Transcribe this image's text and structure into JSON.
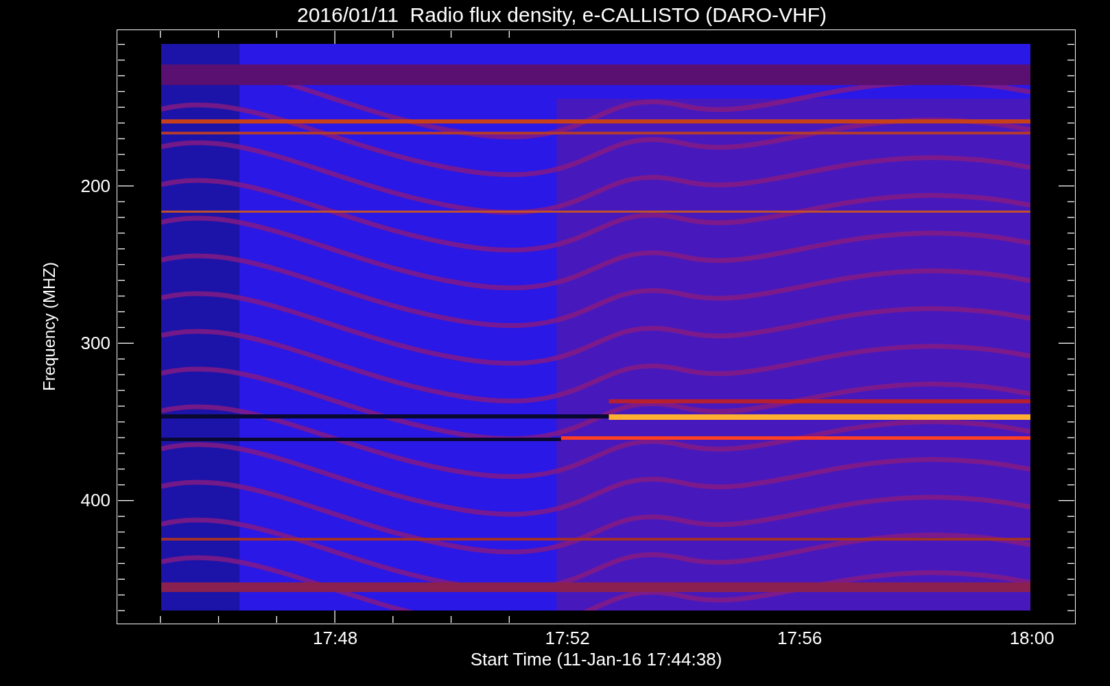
{
  "title": "2016/01/11  Radio flux density, e-CALLISTO (DARO-VHF)",
  "y_axis": {
    "label": "Frequency (MHZ)",
    "ticks": [
      "200",
      "300",
      "400"
    ]
  },
  "x_axis": {
    "label": "Start Time (11-Jan-16 17:44:38)",
    "ticks": [
      "17:48",
      "17:52",
      "17:56",
      "18:00"
    ]
  }
}
